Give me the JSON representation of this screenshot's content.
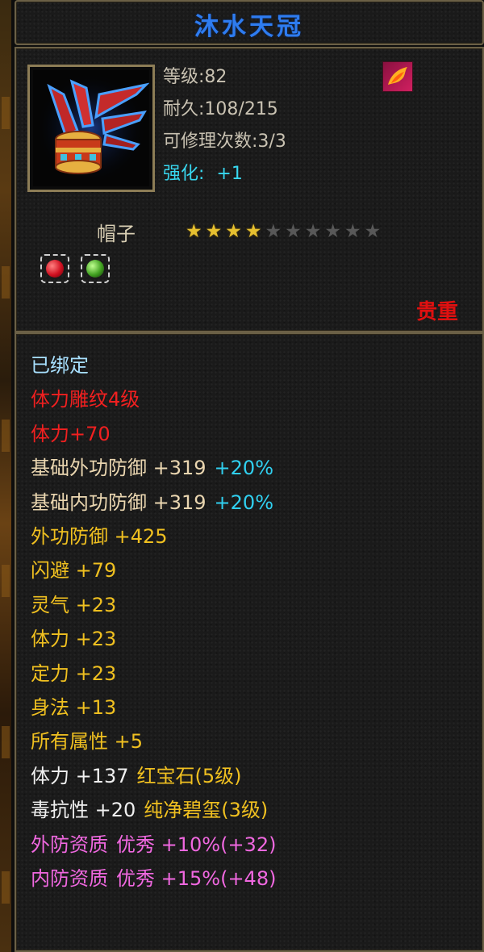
{
  "item": {
    "name": "沐水天冠",
    "level_text": "等级:82",
    "durability_text": "耐久:108/215",
    "repair_text": "可修理次数:3/3",
    "enhance_label": "强化:",
    "enhance_value": "+1",
    "type": "帽子",
    "stars_filled": 4,
    "stars_total": 10,
    "rarity": "贵重",
    "icon": "winged-crown-icon",
    "special_icon": "fire-bird-icon",
    "gems": [
      "red-gem-icon",
      "green-gem-icon"
    ]
  },
  "attributes": [
    {
      "parts": [
        {
          "text": "已绑定",
          "color": "#a8e0ff"
        }
      ]
    },
    {
      "parts": [
        {
          "text": "体力雕纹4级",
          "color": "#f02020"
        }
      ]
    },
    {
      "parts": [
        {
          "text": "体力+70",
          "color": "#f02020"
        }
      ]
    },
    {
      "parts": [
        {
          "text": "基础外功防御  +319",
          "color": "#ead6b0"
        },
        {
          "text": "+20%",
          "color": "#30d0f0"
        }
      ]
    },
    {
      "parts": [
        {
          "text": "基础内功防御  +319",
          "color": "#ead6b0"
        },
        {
          "text": "+20%",
          "color": "#30d0f0"
        }
      ]
    },
    {
      "parts": [
        {
          "text": "外功防御  +425",
          "color": "#f0c020"
        }
      ]
    },
    {
      "parts": [
        {
          "text": "闪避  +79",
          "color": "#f0c020"
        }
      ]
    },
    {
      "parts": [
        {
          "text": "灵气  +23",
          "color": "#f0c020"
        }
      ]
    },
    {
      "parts": [
        {
          "text": "体力  +23",
          "color": "#f0c020"
        }
      ]
    },
    {
      "parts": [
        {
          "text": "定力  +23",
          "color": "#f0c020"
        }
      ]
    },
    {
      "parts": [
        {
          "text": "身法  +13",
          "color": "#f0c020"
        }
      ]
    },
    {
      "parts": [
        {
          "text": "所有属性  +5",
          "color": "#f0c020"
        }
      ]
    },
    {
      "parts": [
        {
          "text": "体力  +137",
          "color": "#f0f0f0"
        },
        {
          "text": "红宝石(5级)",
          "color": "#f0c020"
        }
      ]
    },
    {
      "parts": [
        {
          "text": "毒抗性  +20",
          "color": "#f0f0f0"
        },
        {
          "text": "纯净碧玺(3级)",
          "color": "#f0c020"
        }
      ]
    },
    {
      "parts": [
        {
          "text": "外防资质",
          "color": "#f068e0"
        },
        {
          "text": "优秀 +10%(+32)",
          "color": "#f068e0"
        }
      ]
    },
    {
      "parts": [
        {
          "text": "内防资质",
          "color": "#f068e0"
        },
        {
          "text": "优秀 +15%(+48)",
          "color": "#f068e0"
        }
      ]
    }
  ]
}
